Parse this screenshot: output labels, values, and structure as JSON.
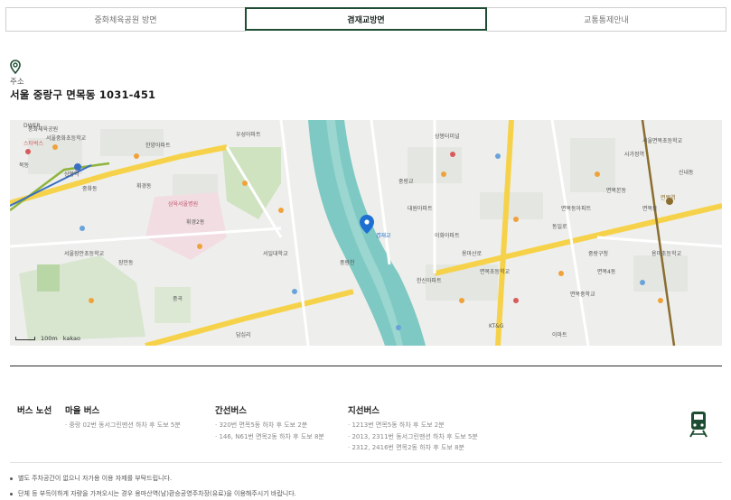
{
  "tabs": [
    {
      "label": "중화체육공원 방면",
      "active": false
    },
    {
      "label": "겸재교방면",
      "active": true
    },
    {
      "label": "교통통제안내",
      "active": false
    }
  ],
  "address": {
    "label": "주소",
    "value": "서울 중랑구 면목동 1031-451"
  },
  "map": {
    "scale_label": "100m",
    "provider": "kakao",
    "labels": [
      "중화체육공원",
      "서울중화초등학교",
      "한양아파트",
      "우성아파트",
      "상봉역",
      "중화동",
      "DWER",
      "스타벅스",
      "묵동",
      "휘경동",
      "서일대학교",
      "면목동",
      "겸재교",
      "중랑천",
      "용마산로",
      "면목역",
      "사가정역",
      "대원아파트",
      "면목초등학교",
      "면목중학교",
      "서울면목초등학교",
      "동일로",
      "중랑구청",
      "휘경2동",
      "삼육서울병원",
      "면목본동",
      "상봉터미널",
      "답십리",
      "장안동",
      "중랑교",
      "이화아파트",
      "한신아파트",
      "서울장안초등학교",
      "면목동아파트",
      "면목4동",
      "용마초등학교",
      "중곡",
      "신내동",
      "KT&G",
      "이마트"
    ],
    "marker_label": "겸재교"
  },
  "bus": {
    "section_title": "버스 노선",
    "columns": [
      {
        "title": "마을 버스",
        "lines": [
          "· 중랑 02번 동서그린맨션 하차 후 도보 5분"
        ]
      },
      {
        "title": "간선버스",
        "lines": [
          "· 320번 면목5동 하차 후 도보 2분",
          "· 146, N61번 면목2동 하차 후 도보 8분"
        ]
      },
      {
        "title": "지선버스",
        "lines": [
          "· 1213번 면목5동 하차 후 도보 2분",
          "· 2013, 2311번 동서그린맨션 하차 후 도보 5분",
          "· 2312, 2416번 면목2동 하차 후 도보 8분"
        ]
      }
    ],
    "train_icon": "train-icon"
  },
  "notes": [
    "별도 주차공간이 없으니 자가용 이용 자제를 부탁드립니다.",
    "단체 등 부득이하게 자량을 가져오시는 경우 용마산역(남)환승공영주차장(유료)을 이용해주시기 바랍니다."
  ],
  "colors": {
    "accent": "#1f4d33",
    "river": "#7ec9c3",
    "marker": "#1d6fd1",
    "subway_green": "#8fb43b",
    "subway_brown": "#8a6d2f"
  }
}
